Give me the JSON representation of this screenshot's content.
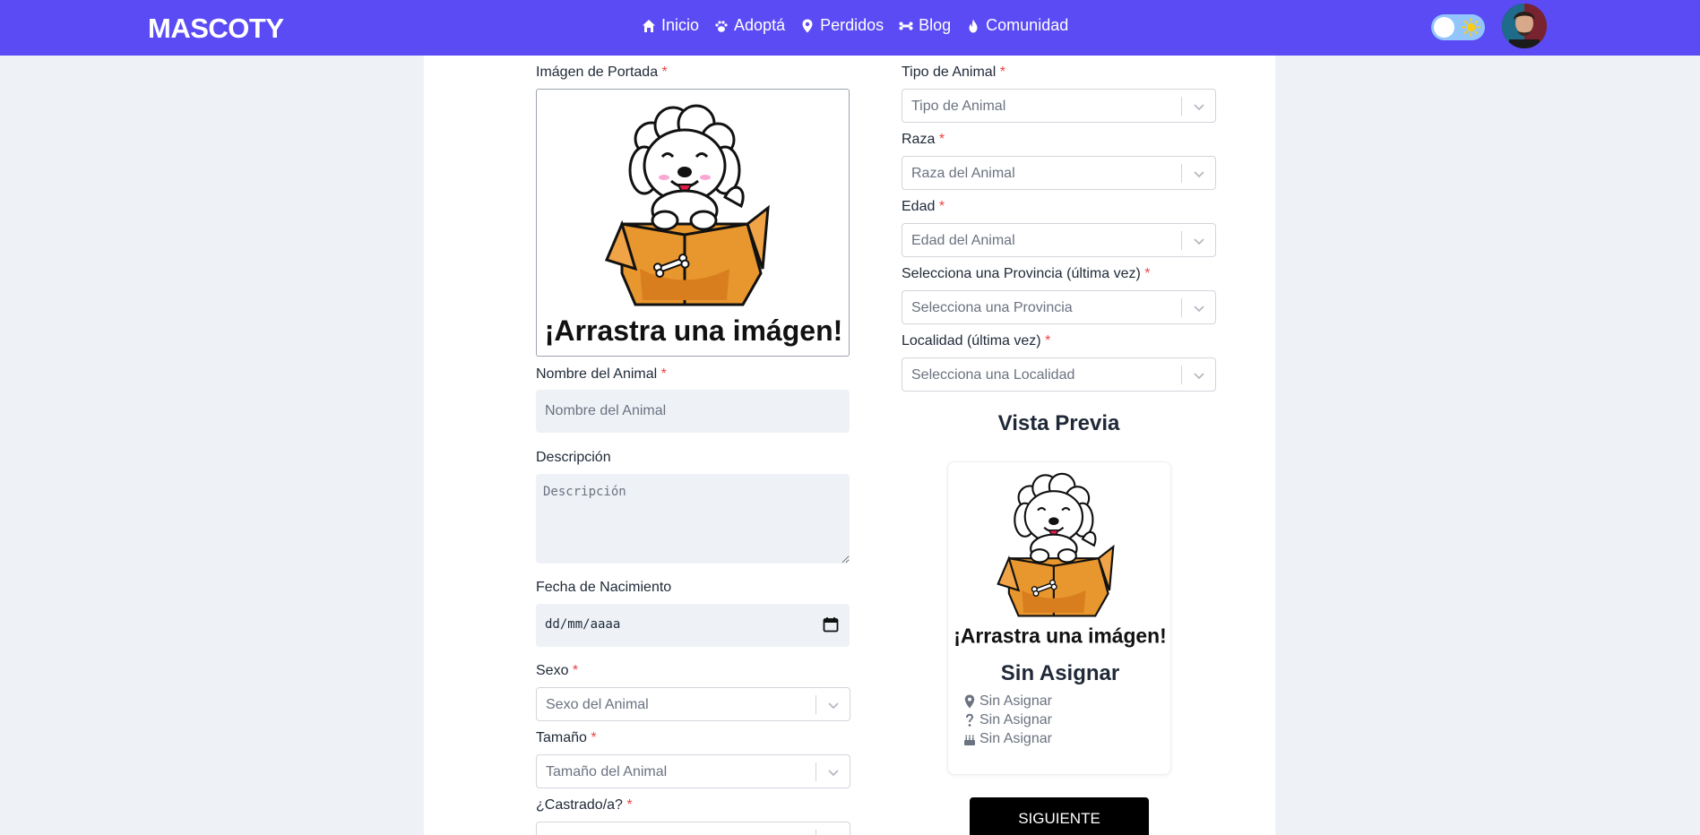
{
  "brand": "MASCOTY",
  "nav": [
    {
      "label": "Inicio",
      "icon": "home-icon"
    },
    {
      "label": "Adoptá",
      "icon": "paw-icon"
    },
    {
      "label": "Perdidos",
      "icon": "location-pin-icon"
    },
    {
      "label": "Blog",
      "icon": "bone-icon"
    },
    {
      "label": "Comunidad",
      "icon": "flame-icon"
    }
  ],
  "form": {
    "cover_label": "Imágen de Portada",
    "dropzone_text": "¡Arrastra una imágen!",
    "name_label": "Nombre del Animal",
    "name_placeholder": "Nombre del Animal",
    "description_label": "Descripción",
    "description_placeholder": "Descripción",
    "birth_label": "Fecha de Nacimiento",
    "birth_value": "dd/mm/aaaa",
    "sex_label": "Sexo",
    "sex_placeholder": "Sexo del Animal",
    "size_label": "Tamaño",
    "size_placeholder": "Tamaño del Animal",
    "neutered_label": "¿Castrado/a?",
    "type_label": "Tipo de Animal",
    "type_placeholder": "Tipo de Animal",
    "breed_label": "Raza",
    "breed_placeholder": "Raza del Animal",
    "age_label": "Edad",
    "age_placeholder": "Edad del Animal",
    "province_label": "Selecciona una Provincia (última vez)",
    "province_placeholder": "Selecciona una Provincia",
    "locality_label": "Localidad (última vez)",
    "locality_placeholder": "Selecciona una Localidad",
    "required_mark": "*"
  },
  "preview": {
    "title": "Vista Previa",
    "image_text": "¡Arrastra una imágen!",
    "name": "Sin Asignar",
    "location": "Sin Asignar",
    "sex": "Sin Asignar",
    "age": "Sin Asignar"
  },
  "next_label": "SIGUIENTE",
  "colors": {
    "navbar": "#5b4bf5",
    "required": "#ef4444",
    "button": "#000000",
    "box": "#e8962e"
  }
}
